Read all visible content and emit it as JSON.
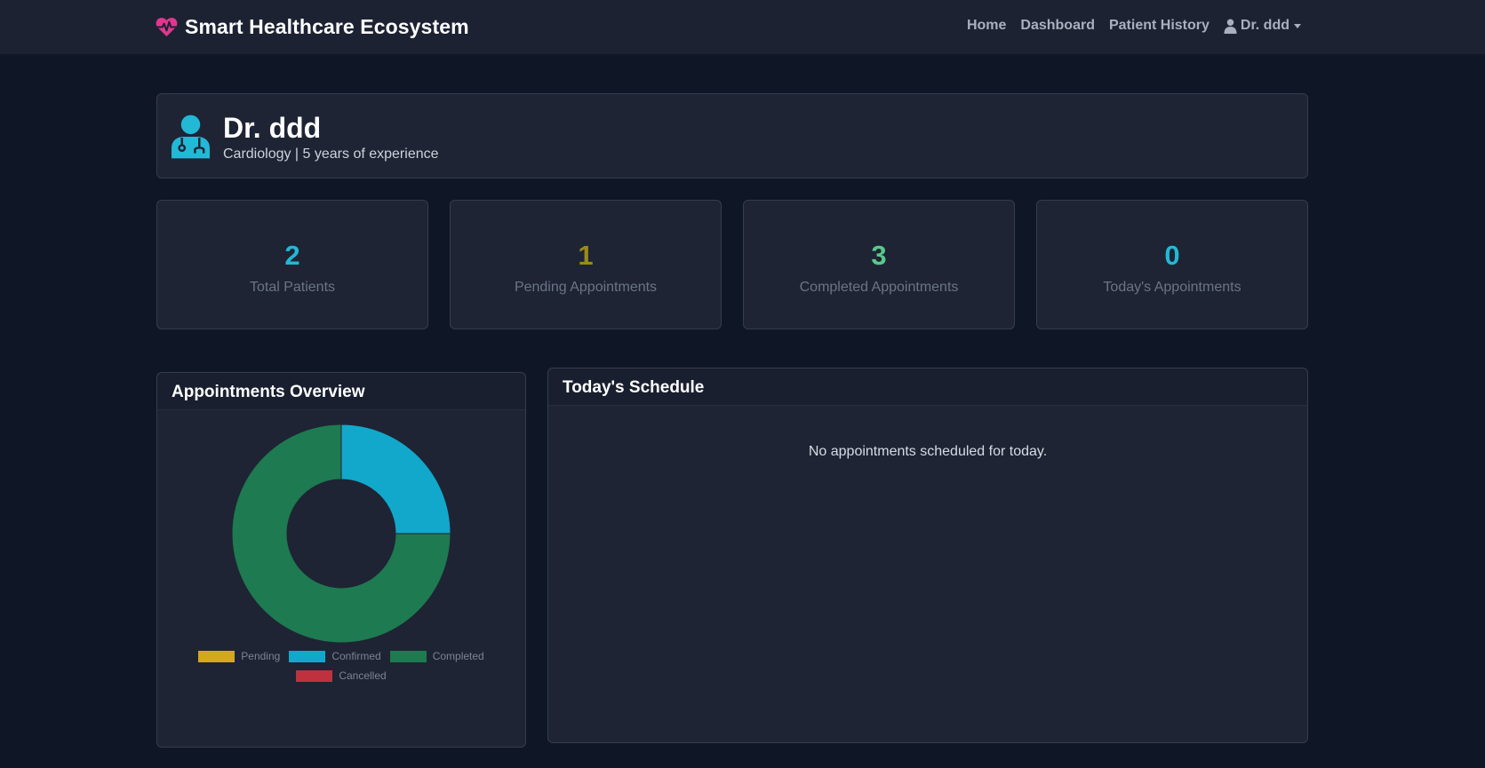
{
  "navbar": {
    "brand": "Smart Healthcare Ecosystem",
    "links": [
      "Home",
      "Dashboard",
      "Patient History"
    ],
    "user": "Dr. ddd"
  },
  "profile": {
    "name": "Dr. ddd",
    "subtitle": "Cardiology | 5 years of experience"
  },
  "stats": [
    {
      "value": "2",
      "label": "Total Patients",
      "color": "#22b8d6"
    },
    {
      "value": "1",
      "label": "Pending Appointments",
      "color": "#9a8b16"
    },
    {
      "value": "3",
      "label": "Completed Appointments",
      "color": "#58c98a"
    },
    {
      "value": "0",
      "label": "Today's Appointments",
      "color": "#22b8d6"
    }
  ],
  "overview": {
    "title": "Appointments Overview"
  },
  "chart_data": {
    "type": "pie",
    "variant": "doughnut",
    "categories": [
      "Pending",
      "Confirmed",
      "Completed",
      "Cancelled"
    ],
    "values": [
      0,
      1,
      3,
      0
    ],
    "colors": [
      "#d4a81c",
      "#12a8cc",
      "#1e7a50",
      "#c0313f"
    ],
    "legend_position": "bottom"
  },
  "schedule": {
    "title": "Today's Schedule",
    "empty_message": "No appointments scheduled for today."
  },
  "icons": {
    "brand": "heartbeat-icon",
    "user": "user-doctor-icon"
  }
}
